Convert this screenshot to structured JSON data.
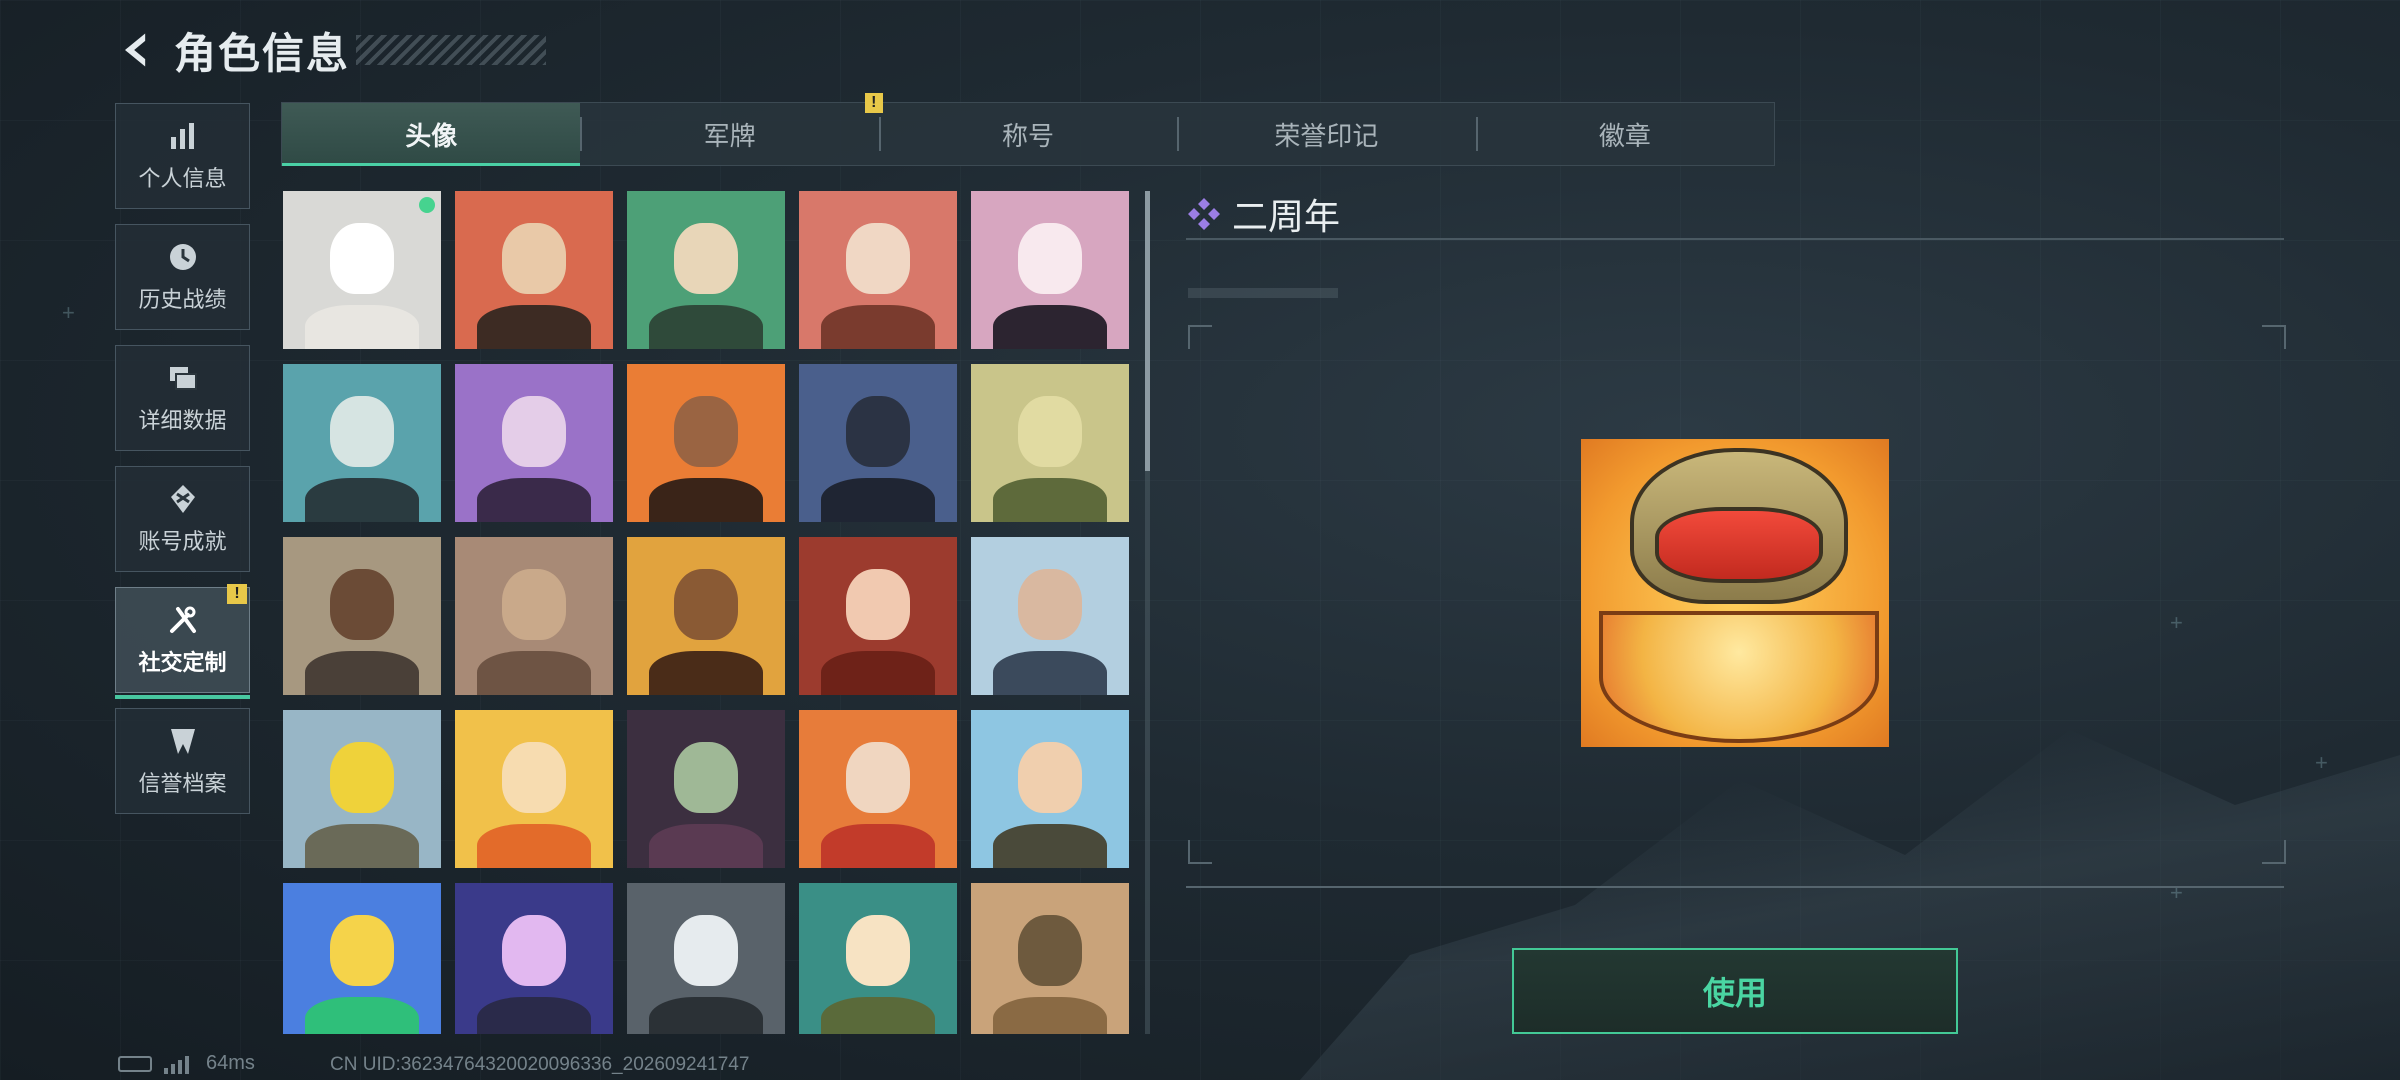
{
  "header": {
    "title": "角色信息"
  },
  "sidebar": {
    "items": [
      {
        "label": "个人信息",
        "icon": "bar-chart-icon"
      },
      {
        "label": "历史战绩",
        "icon": "clock-icon"
      },
      {
        "label": "详细数据",
        "icon": "folders-icon"
      },
      {
        "label": "账号成就",
        "icon": "achievement-icon"
      },
      {
        "label": "社交定制",
        "icon": "tools-icon",
        "active": true,
        "badge": "!"
      },
      {
        "label": "信誉档案",
        "icon": "shield-icon"
      }
    ]
  },
  "tabs": [
    {
      "label": "头像",
      "active": true
    },
    {
      "label": "军牌",
      "badge": "!"
    },
    {
      "label": "称号"
    },
    {
      "label": "荣誉印记"
    },
    {
      "label": "徽章"
    }
  ],
  "avatars": [
    {
      "name": "white-cat-avatar",
      "bg": "#d9d9d6",
      "face": "#ffffff",
      "body": "#e8e6e1",
      "equipped": true
    },
    {
      "name": "bearded-soldier-avatar",
      "bg": "#d96a4f",
      "face": "#e9c9a8",
      "body": "#3d2b23"
    },
    {
      "name": "headset-operator-avatar",
      "bg": "#4da077",
      "face": "#e8d6b8",
      "body": "#2f4a3a"
    },
    {
      "name": "helmet-soldier-avatar",
      "bg": "#d8786a",
      "face": "#f0d7c4",
      "body": "#7a3b2e"
    },
    {
      "name": "white-haired-girl-avatar",
      "bg": "#d7a6c0",
      "face": "#f8e9ee",
      "body": "#2c2430"
    },
    {
      "name": "glasses-man-avatar",
      "bg": "#5aa3ac",
      "face": "#d6e4e2",
      "body": "#2a3b40"
    },
    {
      "name": "purple-pilot-avatar",
      "bg": "#9a72c8",
      "face": "#e4cde8",
      "body": "#3a2a4a"
    },
    {
      "name": "masked-fighter-avatar",
      "bg": "#ea7d35",
      "face": "#9a6442",
      "body": "#3a2418"
    },
    {
      "name": "night-soldier-avatar",
      "bg": "#4a5f8c",
      "face": "#2b3344",
      "body": "#1f2533"
    },
    {
      "name": "exit-door-avatar",
      "bg": "#c9c58a",
      "face": "#e1dba2",
      "body": "#5e6a3b"
    },
    {
      "name": "wasteland-truck-avatar",
      "bg": "#a79880",
      "face": "#6b4b36",
      "body": "#4a4038"
    },
    {
      "name": "scales-emblem-avatar",
      "bg": "#a88a76",
      "face": "#c9a98a",
      "body": "#6e5444"
    },
    {
      "name": "cowboy-gunner-avatar",
      "bg": "#e1a33e",
      "face": "#8a5a34",
      "body": "#4a2c18"
    },
    {
      "name": "red-haired-woman-avatar",
      "bg": "#9c3b2e",
      "face": "#f1c9b0",
      "body": "#6e2218"
    },
    {
      "name": "archer-avatar",
      "bg": "#b3cfe0",
      "face": "#d9b8a0",
      "body": "#3b4a5c"
    },
    {
      "name": "alligator-sign-avatar",
      "bg": "#98b6c6",
      "face": "#efd23a",
      "body": "#6a6a58"
    },
    {
      "name": "shiba-dog-avatar",
      "bg": "#f1c14a",
      "face": "#f7dcb0",
      "body": "#e36b2a"
    },
    {
      "name": "goggles-zombie-avatar",
      "bg": "#3c2f40",
      "face": "#9fb896",
      "body": "#5a3a52"
    },
    {
      "name": "reading-monkey-avatar",
      "bg": "#e77c3a",
      "face": "#f0d6c0",
      "body": "#c23b2a"
    },
    {
      "name": "pyramid-explorer-avatar",
      "bg": "#8ec6e2",
      "face": "#f0cfae",
      "body": "#4a4a3a"
    },
    {
      "name": "party-triangle-avatar",
      "bg": "#4b7fe0",
      "face": "#f5d34a",
      "body": "#2fbf7a"
    },
    {
      "name": "fireworks-2026-avatar",
      "bg": "#3a3a8a",
      "face": "#e2b8f0",
      "body": "#2a2a4a"
    },
    {
      "name": "astronaut-sitting-avatar",
      "bg": "#59626a",
      "face": "#e6ebee",
      "body": "#2b3136"
    },
    {
      "name": "anime-boy-avatar",
      "bg": "#3a8f86",
      "face": "#f7e3c3",
      "body": "#5a6a3a"
    },
    {
      "name": "desert-warrior-avatar",
      "bg": "#c9a37a",
      "face": "#6e5a3e",
      "body": "#8a6a44"
    }
  ],
  "detail": {
    "series_name": "二周年"
  },
  "use_button": {
    "label": "使用"
  },
  "status_bar": {
    "ping": "64ms",
    "uid": "CN UID:36234764320020096336_202609241747"
  },
  "colors": {
    "accent": "#48c7a0",
    "badge": "#e8c849"
  }
}
